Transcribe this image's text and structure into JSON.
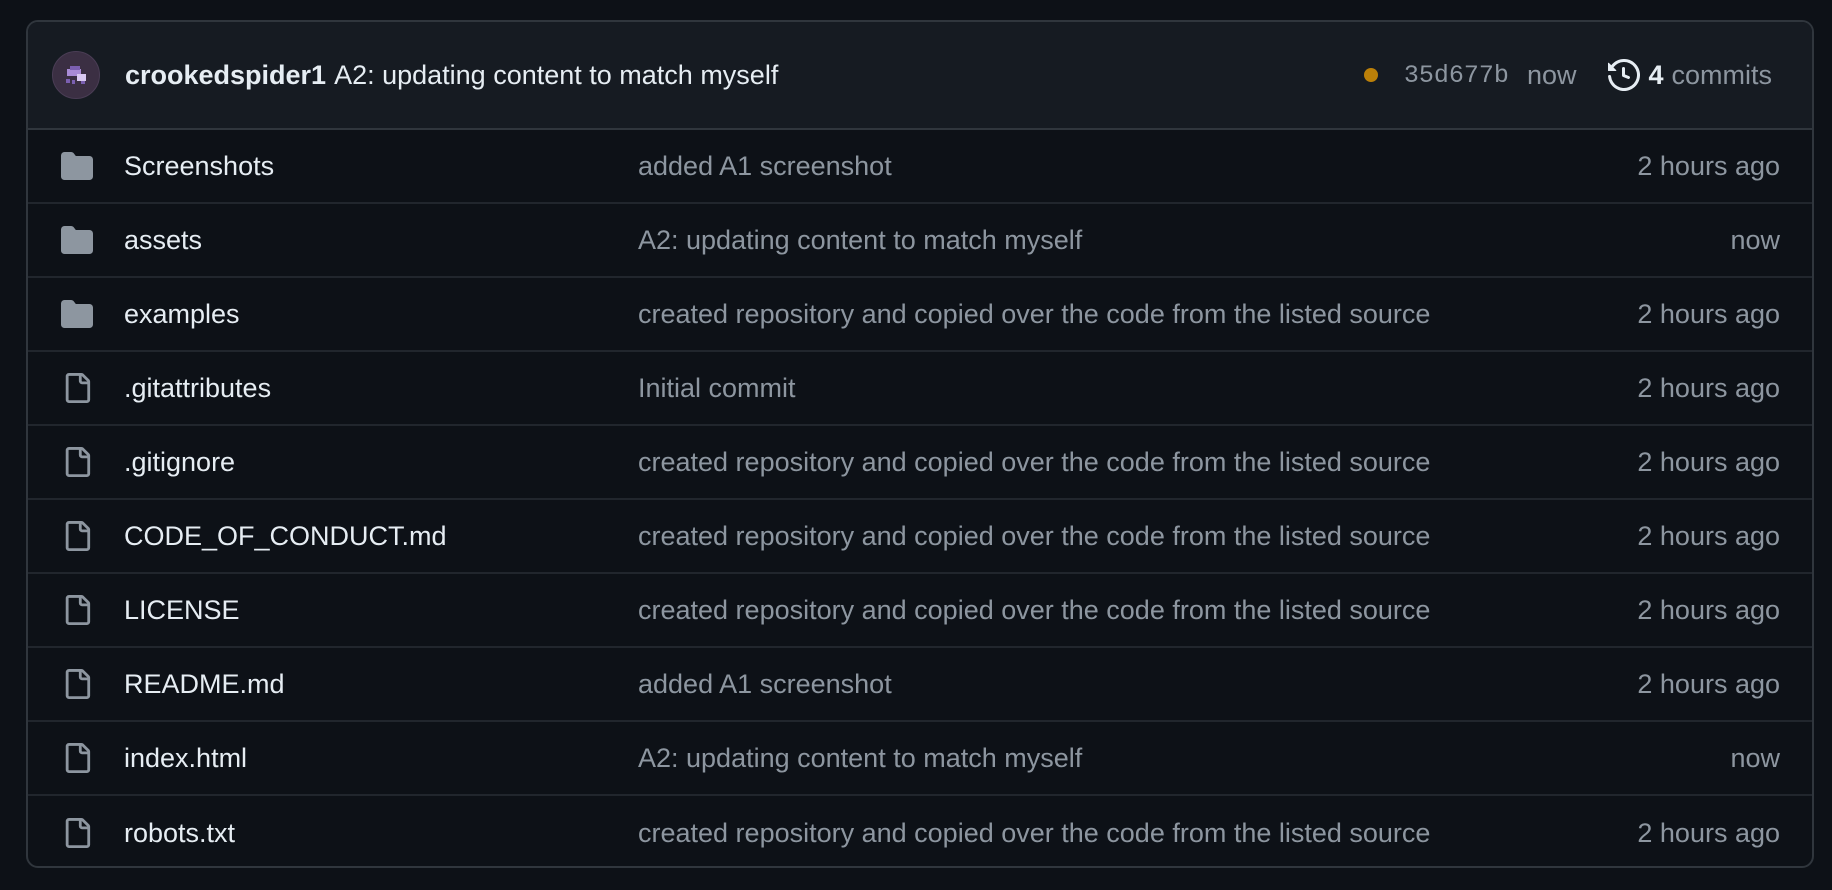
{
  "latest_commit": {
    "author": "crookedspider1",
    "message": "A2: updating content to match myself",
    "status_color": "#bb8009",
    "sha": "35d677b",
    "time": "now",
    "commits_count": "4",
    "commits_label": "commits"
  },
  "files": [
    {
      "type": "folder",
      "icon": "folder-icon",
      "name": "Screenshots",
      "message": "added A1 screenshot",
      "age": "2 hours ago"
    },
    {
      "type": "folder",
      "icon": "folder-icon",
      "name": "assets",
      "message": "A2: updating content to match myself",
      "age": "now"
    },
    {
      "type": "folder",
      "icon": "folder-icon",
      "name": "examples",
      "message": "created repository and copied over the code from the listed source",
      "age": "2 hours ago"
    },
    {
      "type": "file",
      "icon": "file-icon",
      "name": ".gitattributes",
      "message": "Initial commit",
      "age": "2 hours ago"
    },
    {
      "type": "file",
      "icon": "file-icon",
      "name": ".gitignore",
      "message": "created repository and copied over the code from the listed source",
      "age": "2 hours ago"
    },
    {
      "type": "file",
      "icon": "file-icon",
      "name": "CODE_OF_CONDUCT.md",
      "message": "created repository and copied over the code from the listed source",
      "age": "2 hours ago"
    },
    {
      "type": "file",
      "icon": "file-icon",
      "name": "LICENSE",
      "message": "created repository and copied over the code from the listed source",
      "age": "2 hours ago"
    },
    {
      "type": "file",
      "icon": "file-icon",
      "name": "README.md",
      "message": "added A1 screenshot",
      "age": "2 hours ago"
    },
    {
      "type": "file",
      "icon": "file-icon",
      "name": "index.html",
      "message": "A2: updating content to match myself",
      "age": "now"
    },
    {
      "type": "file",
      "icon": "file-icon",
      "name": "robots.txt",
      "message": "created repository and copied over the code from the listed source",
      "age": "2 hours ago"
    }
  ]
}
